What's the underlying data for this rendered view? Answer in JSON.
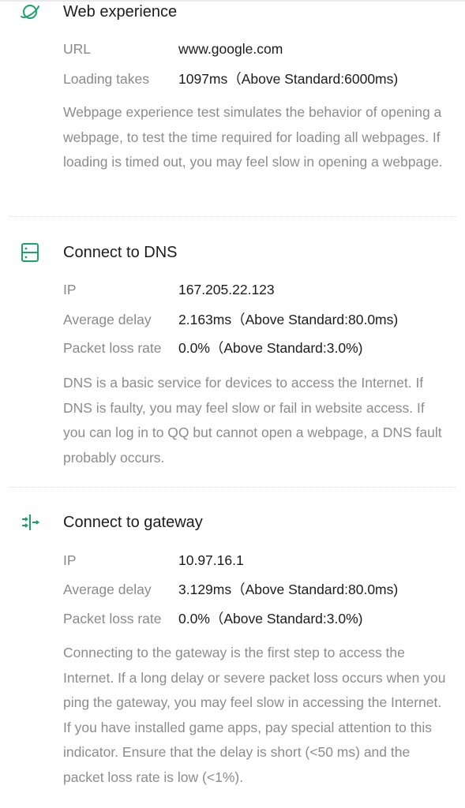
{
  "web": {
    "title": "Web experience",
    "url_label": "URL",
    "url_value": "www.google.com",
    "loading_label": "Loading takes",
    "loading_value": "1097ms（Above Standard:6000ms)",
    "description": "Webpage experience test simulates the behavior of opening a webpage, to test the time required for loading all webpages. If loading is timed out, you may feel slow in opening a webpage."
  },
  "dns": {
    "title": "Connect to DNS",
    "ip_label": "IP",
    "ip_value": "167.205.22.123",
    "delay_label": "Average delay",
    "delay_value": "2.163ms（Above Standard:80.0ms)",
    "loss_label": "Packet loss rate",
    "loss_value": "0.0%（Above Standard:3.0%)",
    "description": "DNS is a basic service for devices to access the Internet. If DNS is faulty, you may feel slow or fail in website access. If you can log in to QQ but cannot open a webpage, a DNS fault probably occurs."
  },
  "gateway": {
    "title": "Connect to gateway",
    "ip_label": "IP",
    "ip_value": "10.97.16.1",
    "delay_label": "Average delay",
    "delay_value": "3.129ms（Above Standard:80.0ms)",
    "loss_label": "Packet loss rate",
    "loss_value": "0.0%（Above Standard:3.0%)",
    "description": "Connecting to the gateway is the first step to access the Internet. If a long delay or severe packet loss occurs when you ping the gateway, you may feel slow in accessing the Internet. If you have installed game apps, pay special attention to this indicator. Ensure that the delay is short (<50 ms) and the packet loss rate is low (<1%)."
  },
  "icons": {
    "web": "planet-icon",
    "dns": "server-icon",
    "gateway": "gateway-arrows-icon"
  },
  "colors": {
    "accent": "#1aa36b",
    "label": "#8a8a8a",
    "text": "#1c1c1c"
  }
}
